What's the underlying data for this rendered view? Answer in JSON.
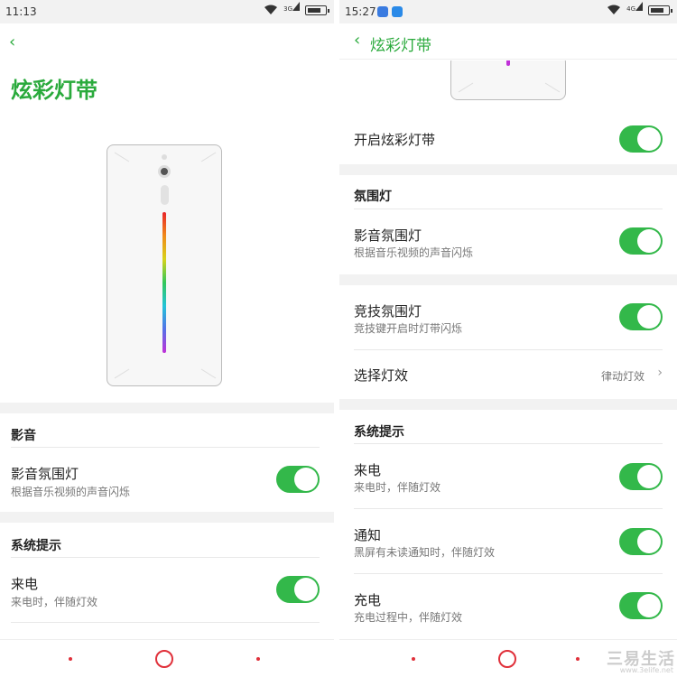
{
  "left": {
    "status": {
      "time": "11:13",
      "signal": "3G"
    },
    "page_title": "炫彩灯带",
    "sections": {
      "media_header": "影音",
      "system_header": "系统提示"
    },
    "rows": {
      "media_light": {
        "title": "影音氛围灯",
        "sub": "根据音乐视频的声音闪烁",
        "on": true
      },
      "incoming_call": {
        "title": "来电",
        "sub": "来电时，伴随灯效",
        "on": true
      }
    }
  },
  "right": {
    "status": {
      "time": "15:27",
      "signal": "4G"
    },
    "page_title": "炫彩灯带",
    "sections": {
      "ambient_header": "氛围灯",
      "system_header": "系统提示"
    },
    "rows": {
      "enable": {
        "title": "开启炫彩灯带",
        "on": true
      },
      "media_light": {
        "title": "影音氛围灯",
        "sub": "根据音乐视频的声音闪烁",
        "on": true
      },
      "game_light": {
        "title": "竞技氛围灯",
        "sub": "竞技键开启时灯带闪烁",
        "on": true
      },
      "effect": {
        "title": "选择灯效",
        "value": "律动灯效"
      },
      "incoming_call": {
        "title": "来电",
        "sub": "来电时，伴随灯效",
        "on": true
      },
      "notification": {
        "title": "通知",
        "sub": "黑屏有未读通知时，伴随灯效",
        "on": true
      },
      "charging": {
        "title": "充电",
        "sub": "充电过程中，伴随灯效",
        "on": true
      }
    }
  },
  "watermark": {
    "main": "三易生活",
    "sub": "www.3elife.net"
  },
  "colors": {
    "accent": "#2aaa3c",
    "toggle_on": "#33b84a",
    "nav": "#e0303a"
  }
}
